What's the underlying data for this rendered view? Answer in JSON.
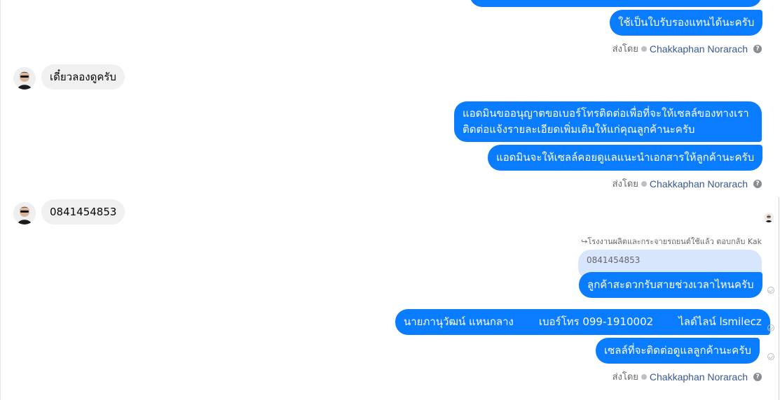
{
  "thread": {
    "sender_label": "ส่งโดย",
    "sender_name": "Chakkaphan Norarach",
    "help_icon_text": "?",
    "msg_top": "ใช้เป็นใบรับรองแทนได้นะครับ",
    "msg_in_1": "เดี๋ยวลองดูครับ",
    "msg_out_2a_line1": "แอดมินขออนุญาตขอเบอร์โทรติดต่อเพื่อที่จะให้เซลล์ของทางเรา",
    "msg_out_2a_line2": "ติดต่อแจ้งรายละเอียดเพิ่มเติมให้แก่คุณลูกค้านะครับ",
    "msg_out_2b": "แอดมินจะให้เซลล์คอยดูแลแนะนำเอกสารให้ลูกค้านะครับ",
    "msg_in_2": "0841454853",
    "reply_meta": "โรงงานผลิตและกระจายรถยนต์ใช้แล้ว ตอบกลับ Kak",
    "reply_quote": "0841454853",
    "msg_out_3a": "ลูกค้าสะดวกรับสายช่วงเวลาไหนครับ",
    "msg_out_3b_part1": "นายภานุวัฒน์ แหนกลาง",
    "msg_out_3b_part2": "เบอร์โทร 099-1910002",
    "msg_out_3b_part3": "ไลด์ไลน์ lsmilecz",
    "msg_out_3c": "เซลล์ที่จะติดต่อดูแลลูกค้านะครับ"
  },
  "colors": {
    "outgoing_bubble": "#0a7cff",
    "incoming_bubble": "#f0f0f0",
    "reply_bubble": "#d8e6fd",
    "sender_name": "#385898"
  }
}
